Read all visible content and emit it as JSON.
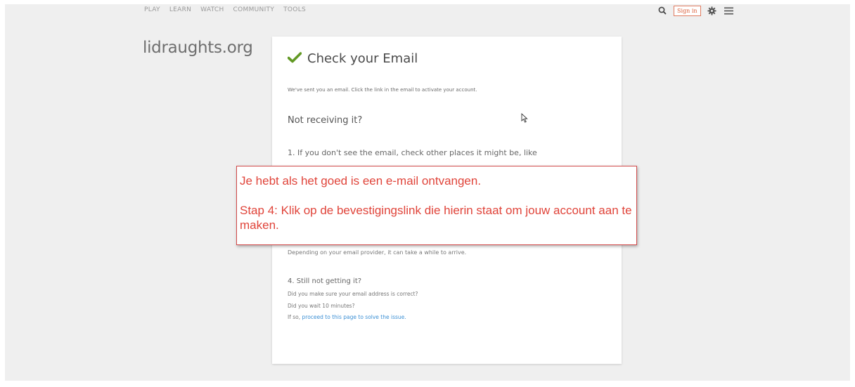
{
  "nav": {
    "items": [
      "PLAY",
      "LEARN",
      "WATCH",
      "COMMUNITY",
      "TOOLS"
    ],
    "signin_label": "Sign in"
  },
  "icons": [
    "search-icon",
    "gear-icon",
    "menu-icon",
    "check-icon",
    "cursor-icon"
  ],
  "logo": "lidraughts.org",
  "card": {
    "title": "Check your Email",
    "lead": "We've sent you an email. Click the link in the email to activate your account.",
    "subtitle": "Not receiving it?",
    "step1": "1. If you don't see the email, check other places it might be, like",
    "step3_text": "Depending on your email provider, it can take a while to arrive.",
    "step4_heading": "4. Still not getting it?",
    "step4_line1": "Did you make sure your email address is correct?",
    "step4_line2": "Did you wait 10 minutes?",
    "step4_prefix": "If so, ",
    "step4_link": "proceed to this page to solve the issue."
  },
  "overlay": {
    "line1": "Je hebt als het goed is een e-mail ontvangen.",
    "line2": "Stap 4: Klik op de bevestigingslink die hierin staat om jouw account aan te maken."
  },
  "colors": {
    "accent": "#d95f3b",
    "check": "#629924",
    "overlay_text": "#e0443a",
    "link": "#3b8fd4"
  }
}
